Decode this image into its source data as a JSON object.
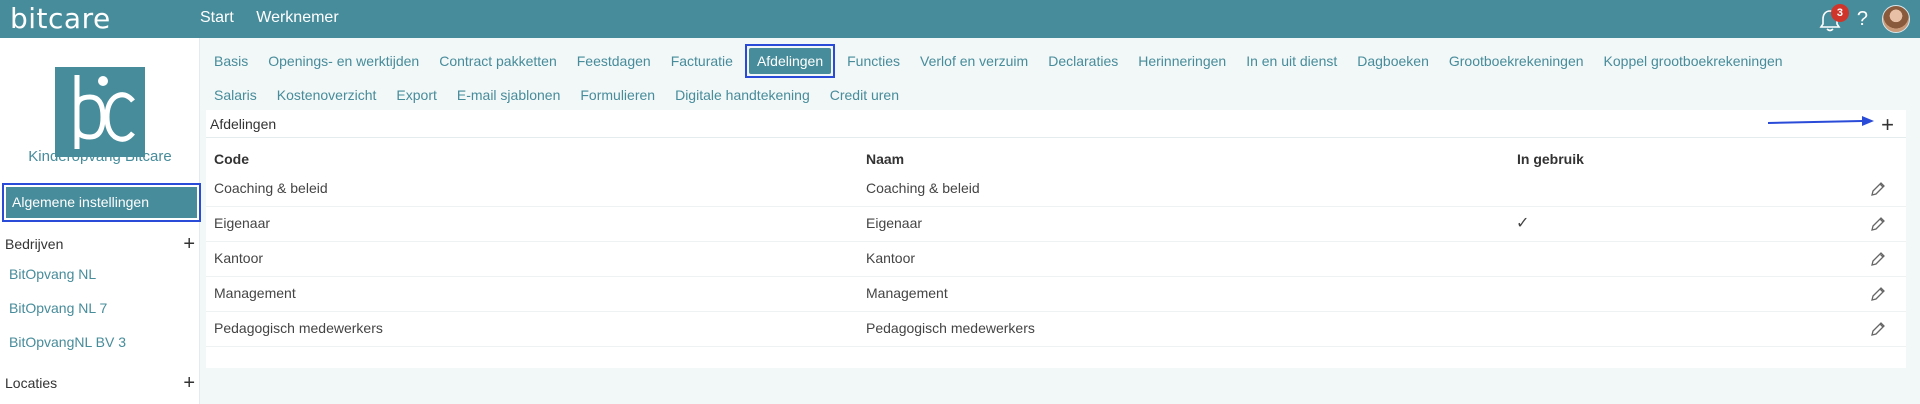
{
  "app": {
    "logo_text": "bitcare",
    "top_nav": [
      "Start",
      "Werknemer"
    ],
    "notifications_count": "3",
    "help_label": "?"
  },
  "sidebar": {
    "org_name": "Kinderopvang Bitcare",
    "active_item": "Algemene instellingen",
    "companies_label": "Bedrijven",
    "companies": [
      "BitOpvang NL",
      "BitOpvang NL 7",
      "BitOpvangNL BV 3"
    ],
    "locations_label": "Locaties",
    "plus": "+"
  },
  "tabs": {
    "row1": [
      "Basis",
      "Openings- en werktijden",
      "Contract pakketten",
      "Feestdagen",
      "Facturatie",
      "Afdelingen",
      "Functies",
      "Verlof en verzuim",
      "Declaraties",
      "Herinneringen",
      "In en uit dienst",
      "Dagboeken",
      "Grootboekrekeningen",
      "Koppel grootboekrekeningen"
    ],
    "row2": [
      "Salaris",
      "Kostenoverzicht",
      "Export",
      "E-mail sjablonen",
      "Formulieren",
      "Digitale handtekening",
      "Credit uren"
    ],
    "active": "Afdelingen"
  },
  "panel": {
    "title": "Afdelingen",
    "add": "+",
    "columns": {
      "code": "Code",
      "name": "Naam",
      "in_use": "In gebruik"
    },
    "rows": [
      {
        "code": "Coaching & beleid",
        "name": "Coaching & beleid",
        "in_use": ""
      },
      {
        "code": "Eigenaar",
        "name": "Eigenaar",
        "in_use": "✓"
      },
      {
        "code": "Kantoor",
        "name": "Kantoor",
        "in_use": ""
      },
      {
        "code": "Management",
        "name": "Management",
        "in_use": ""
      },
      {
        "code": "Pedagogisch medewerkers",
        "name": "Pedagogisch medewerkers",
        "in_use": ""
      }
    ]
  },
  "colors": {
    "brand": "#478c9b",
    "highlight": "#2a4bd8",
    "badge": "#d0352b"
  }
}
